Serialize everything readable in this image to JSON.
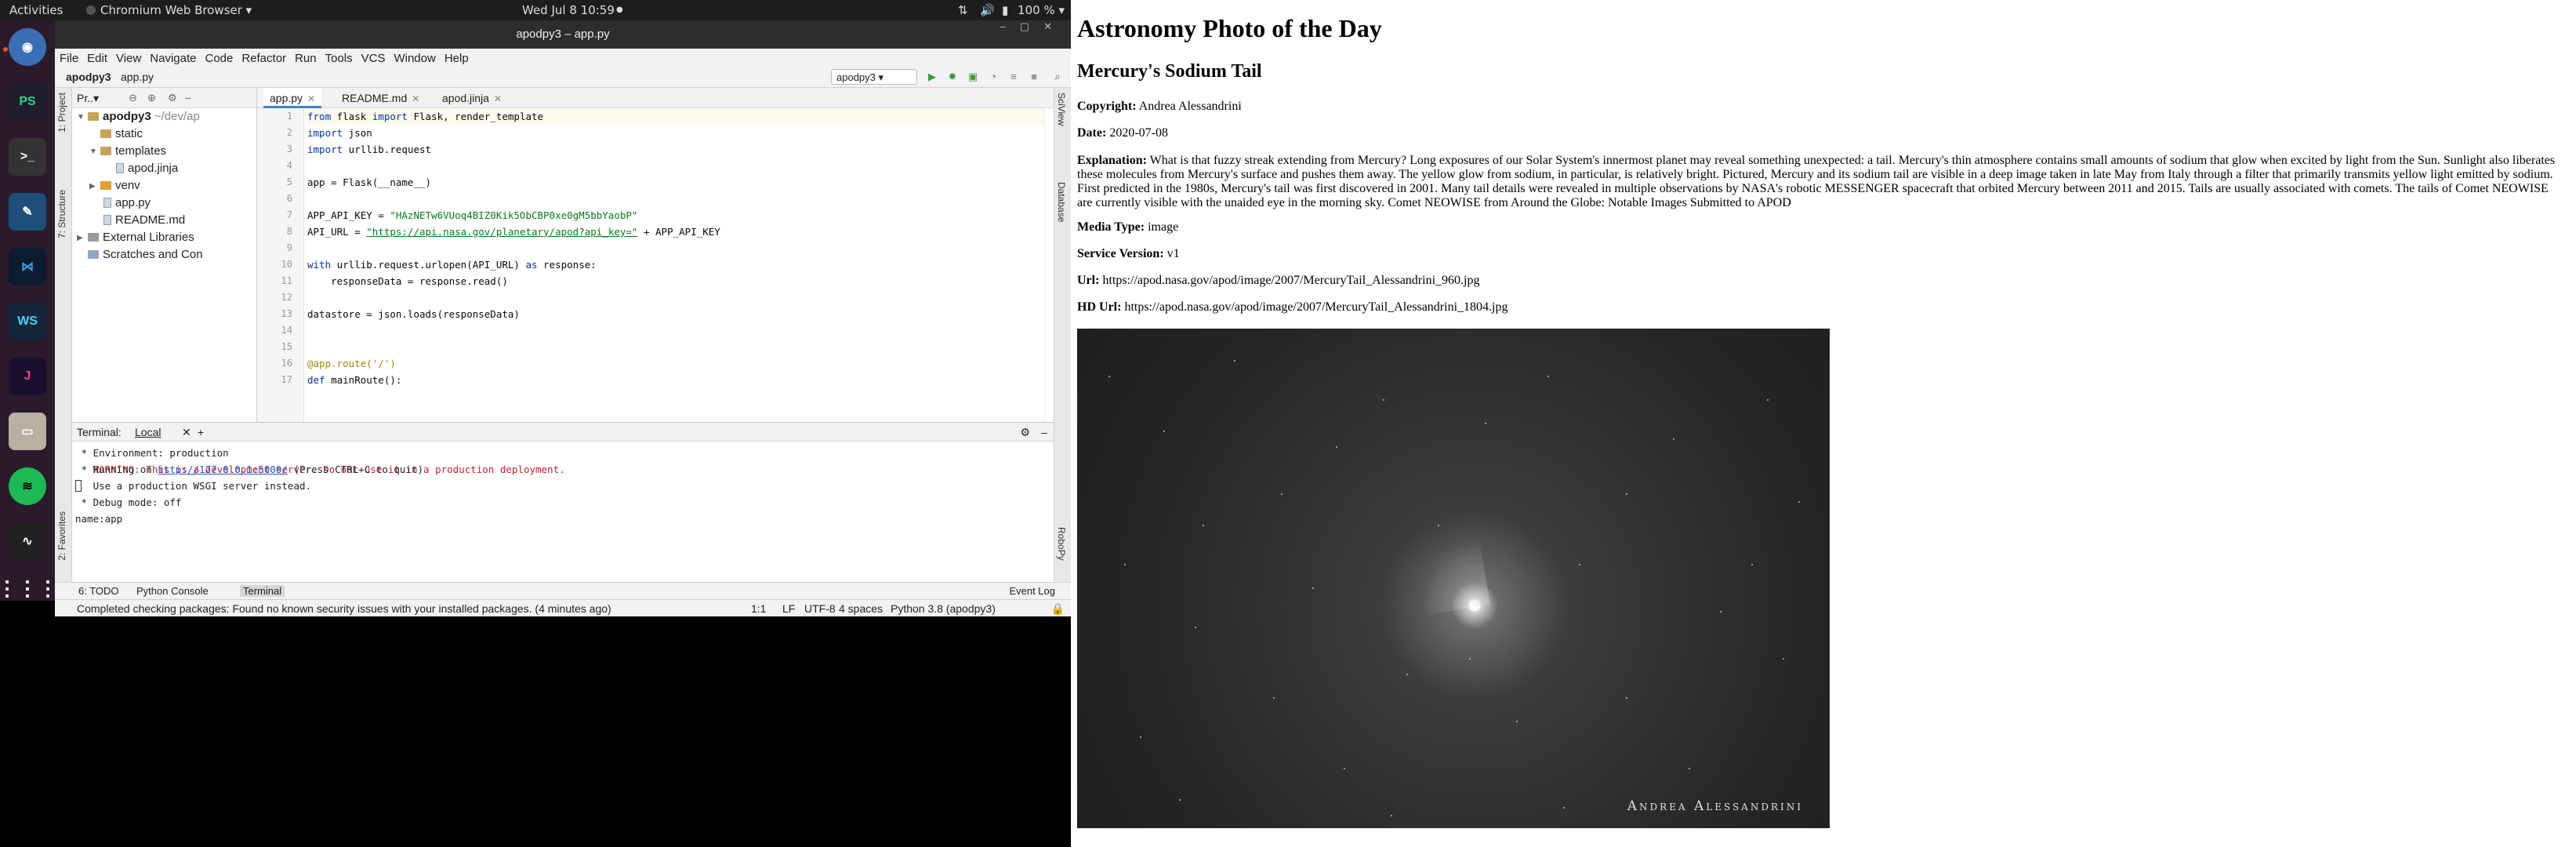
{
  "topbar": {
    "activities": "Activities",
    "app_menu": "Chromium Web Browser ▾",
    "clock": "Wed Jul 8  10:59",
    "tray": "100 % ▾"
  },
  "ide": {
    "window_title": "apodpy3 – app.py",
    "menu": [
      "File",
      "Edit",
      "View",
      "Navigate",
      "Code",
      "Refactor",
      "Run",
      "Tools",
      "VCS",
      "Window",
      "Help"
    ],
    "breadcrumb": {
      "project": "apodpy3",
      "file": "app.py"
    },
    "run_config": "apodpy3 ▾",
    "left_tool_labels": {
      "project": "1: Project",
      "structure": "7: Structure",
      "favorites": "2: Favorites"
    },
    "right_tool_labels": {
      "sciview": "SciView",
      "database": "Database",
      "robopy": "RoboPy"
    },
    "project_panel": {
      "title": "Pr..▾",
      "tree": [
        {
          "label": "apodpy3",
          "hint": "~/dev/ap"
        },
        {
          "label": "static"
        },
        {
          "label": "templates"
        },
        {
          "label": "apod.jinja"
        },
        {
          "label": "venv"
        },
        {
          "label": "app.py"
        },
        {
          "label": "README.md"
        },
        {
          "label": "External Libraries"
        },
        {
          "label": "Scratches and Con"
        }
      ]
    },
    "tabs": [
      "app.py",
      "README.md",
      "apod.jinja"
    ],
    "line_numbers": [
      "1",
      "2",
      "3",
      "4",
      "5",
      "6",
      "7",
      "8",
      "9",
      "10",
      "11",
      "12",
      "13",
      "14",
      "15",
      "16",
      "17"
    ],
    "code": [
      {
        "kw": "from",
        "a": " flask ",
        "kw2": "import",
        "b": " Flask, render_template"
      },
      {
        "kw": "import",
        "a": " json"
      },
      {
        "kw": "import",
        "a": " urllib.request"
      },
      {
        "a": ""
      },
      {
        "a": "app = Flask(__name__)"
      },
      {
        "a": ""
      },
      {
        "a": "APP_API_KEY = ",
        "str": "\"HAzNETw6VUoq4BIZ0Kik5ObCBP0xe0gM5bbYaobP\""
      },
      {
        "a": "API_URL = ",
        "url": "\"https://api.nasa.gov/planetary/apod?api_key=\"",
        "b": " + APP_API_KEY"
      },
      {
        "a": ""
      },
      {
        "kw": "with",
        "a": " urllib.request.urlopen(API_URL) ",
        "kw2": "as",
        "b": " response:"
      },
      {
        "a": "    responseData = response.read()"
      },
      {
        "a": ""
      },
      {
        "a": "datastore = json.loads(responseData)"
      },
      {
        "a": ""
      },
      {
        "a": ""
      },
      {
        "fn": "@app.route('/')",
        "a": ""
      },
      {
        "kw": "def",
        "a": " mainRoute():"
      }
    ],
    "terminal": {
      "title": "Terminal:",
      "tab": "Local",
      "lines": [
        {
          "text": " * Environment: production",
          "cls": ""
        },
        {
          "text": "   WARNING: This is a development server. Do not use it in a production deployment.",
          "cls": "warn"
        },
        {
          "text": "   Use a production WSGI server instead.",
          "cls": ""
        },
        {
          "text": " * Debug mode: off",
          "cls": ""
        },
        {
          "text": "name:app",
          "cls": ""
        }
      ],
      "running_prefix": " * Running on ",
      "running_url": "http://127.0.0.1:5000/",
      "running_suffix": " (Press CTRL+C to quit)"
    },
    "toolwindows": {
      "todo": "6: TODO",
      "console": "Python Console",
      "terminal": "Terminal",
      "eventlog": "Event Log"
    },
    "status": {
      "message": "Completed checking packages: Found no known security issues with your installed packages. (4 minutes ago)",
      "position": "1:1",
      "line_sep": "LF",
      "encoding": "UTF-8",
      "indent": "4 spaces",
      "interpreter": "Python 3.8 (apodpy3)"
    }
  },
  "browser": {
    "heading": "Astronomy Photo of the Day",
    "title": "Mercury's Sodium Tail",
    "copyright_label": "Copyright:",
    "copyright": " Andrea Alessandrini",
    "date_label": "Date:",
    "date": " 2020-07-08",
    "explanation_label": "Explanation:",
    "explanation": " What is that fuzzy streak extending from Mercury? Long exposures of our Solar System's innermost planet may reveal something unexpected: a tail. Mercury's thin atmosphere contains small amounts of sodium that glow when excited by light from the Sun. Sunlight also liberates these molecules from Mercury's surface and pushes them away. The yellow glow from sodium, in particular, is relatively bright. Pictured, Mercury and its sodium tail are visible in a deep image taken in late May from Italy through a filter that primarily transmits yellow light emitted by sodium. First predicted in the 1980s, Mercury's tail was first discovered in 2001. Many tail details were revealed in multiple observations by NASA's robotic MESSENGER spacecraft that orbited Mercury between 2011 and 2015. Tails are usually associated with comets. The tails of Comet NEOWISE are currently visible with the unaided eye in the morning sky. Comet NEOWISE from Around the Globe: Notable Images Submitted to APOD",
    "media_type_label": "Media Type:",
    "media_type": " image",
    "service_version_label": "Service Version:",
    "service_version": " v1",
    "url_label": "Url:",
    "url": " https://apod.nasa.gov/apod/image/2007/MercuryTail_Alessandrini_960.jpg",
    "hdurl_label": "HD Url:",
    "hdurl": " https://apod.nasa.gov/apod/image/2007/MercuryTail_Alessandrini_1804.jpg",
    "image_signature": "Andrea Alessandrini"
  }
}
